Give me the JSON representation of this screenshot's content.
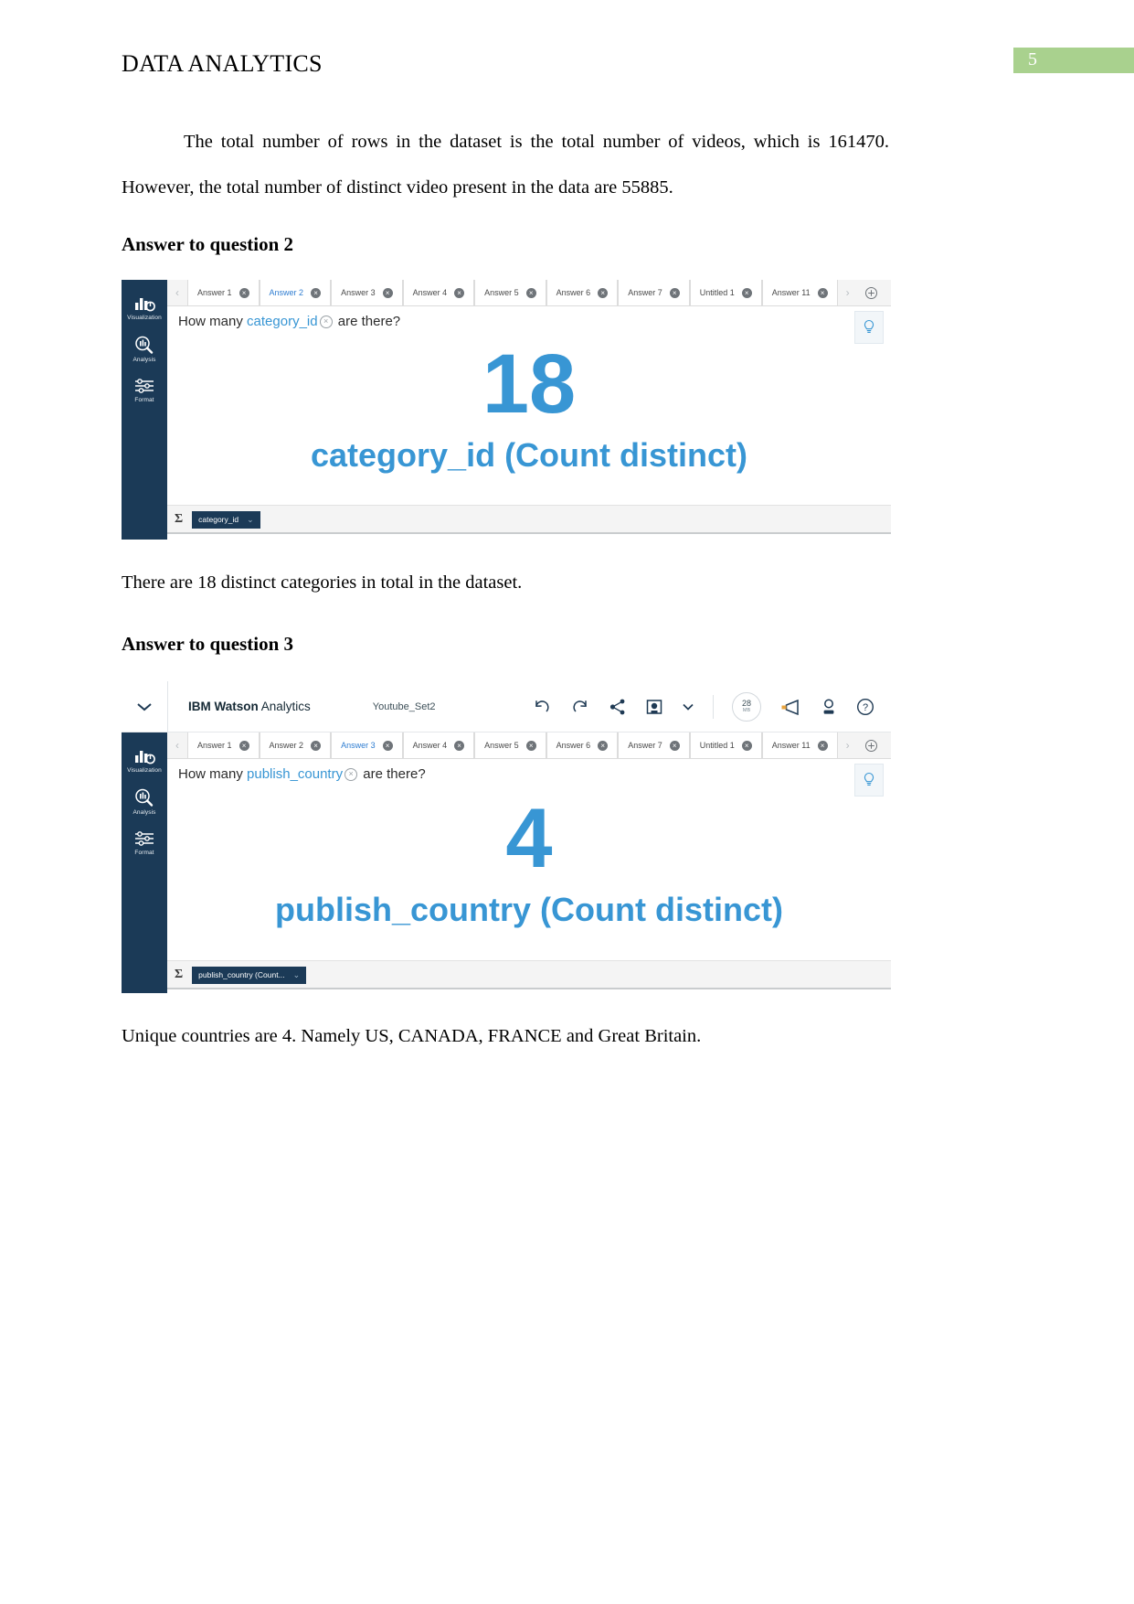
{
  "document": {
    "header_title": "DATA ANALYTICS",
    "page_number": "5",
    "page_badge_color": "#a9d18e",
    "paragraph_1": "The total number of rows in the dataset is the total number of videos, which is 161470. However, the total number of distinct video present in the data are 55885.",
    "heading_q2": "Answer to question 2",
    "caption_q2": "There are 18 distinct categories in total in the dataset.",
    "heading_q3": "Answer to question 3",
    "caption_q3": "Unique countries are 4. Namely US, CANADA, FRANCE and Great Britain."
  },
  "app": {
    "accent_blue": "#3896d4",
    "sidebar_navy": "#1b3a57",
    "toolbar": {
      "brand_bold": "IBM Watson",
      "brand_light": " Analytics",
      "dataset_name": "Youtube_Set2",
      "size_value": "28",
      "size_unit": "MB",
      "icons": [
        "caret-down-icon",
        "undo-icon",
        "redo-icon",
        "share-icon",
        "save-icon",
        "chevron-down-icon",
        "storage-size-chip",
        "megaphone-icon",
        "user-icon",
        "help-icon"
      ]
    },
    "sidebar_items": [
      {
        "label": "Visualization",
        "icon": "bar-chart-icon"
      },
      {
        "label": "Analysis",
        "icon": "analysis-magnifier-icon"
      },
      {
        "label": "Format",
        "icon": "sliders-icon"
      }
    ]
  },
  "screenshot_q2": {
    "tabs": [
      {
        "label": "Answer 1",
        "active": false
      },
      {
        "label": "Answer 2",
        "active": true
      },
      {
        "label": "Answer 3",
        "active": false
      },
      {
        "label": "Answer 4",
        "active": false
      },
      {
        "label": "Answer 5",
        "active": false
      },
      {
        "label": "Answer 6",
        "active": false
      },
      {
        "label": "Answer 7",
        "active": false
      },
      {
        "label": "Untitled 1",
        "active": false
      },
      {
        "label": "Answer 11",
        "active": false
      }
    ],
    "query_prefix": "How many",
    "query_field": "category_id",
    "query_suffix": "are there?",
    "big_number": "18",
    "big_label": "category_id (Count distinct)",
    "bottom_sigma": "Σ",
    "bottom_pill": "category_id"
  },
  "screenshot_q3": {
    "tabs": [
      {
        "label": "Answer 1",
        "active": false
      },
      {
        "label": "Answer 2",
        "active": false
      },
      {
        "label": "Answer 3",
        "active": true
      },
      {
        "label": "Answer 4",
        "active": false
      },
      {
        "label": "Answer 5",
        "active": false
      },
      {
        "label": "Answer 6",
        "active": false
      },
      {
        "label": "Answer 7",
        "active": false
      },
      {
        "label": "Untitled 1",
        "active": false
      },
      {
        "label": "Answer 11",
        "active": false
      }
    ],
    "query_prefix": "How many",
    "query_field": "publish_country",
    "query_suffix": "are there?",
    "big_number": "4",
    "big_label": "publish_country (Count distinct)",
    "bottom_sigma": "Σ",
    "bottom_pill": "publish_country (Count..."
  }
}
